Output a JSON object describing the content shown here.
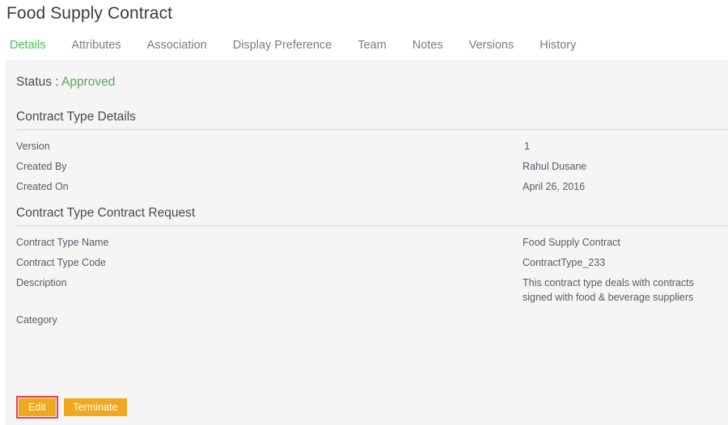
{
  "header": {
    "title": "Food Supply Contract"
  },
  "tabs": [
    {
      "label": "Details",
      "active": true
    },
    {
      "label": "Attributes",
      "active": false
    },
    {
      "label": "Association",
      "active": false
    },
    {
      "label": "Display Preference",
      "active": false
    },
    {
      "label": "Team",
      "active": false
    },
    {
      "label": "Notes",
      "active": false
    },
    {
      "label": "Versions",
      "active": false
    },
    {
      "label": "History",
      "active": false
    }
  ],
  "status": {
    "label": "Status :",
    "value": "Approved"
  },
  "sections": [
    {
      "title": "Contract Type Details",
      "rows": [
        {
          "label": "Version",
          "value": "1"
        },
        {
          "label": "Created By",
          "value": "Rahul Dusane"
        },
        {
          "label": "Created On",
          "value": "April 26, 2016"
        }
      ]
    },
    {
      "title": "Contract Type Contract Request",
      "rows": [
        {
          "label": "Contract Type Name",
          "value": "Food Supply Contract"
        },
        {
          "label": "Contract Type Code",
          "value": "ContractType_233"
        },
        {
          "label": "Description",
          "value": "This contract type deals with contracts\nsigned with food & beverage suppliers"
        },
        {
          "label": "Category",
          "value": ""
        }
      ]
    }
  ],
  "footer": {
    "edit_label": "Edit",
    "terminate_label": "Terminate"
  },
  "colors": {
    "accent_green": "#4cc04c",
    "status_green": "#5ba75b",
    "button_orange": "#f0a81e",
    "highlight_red": "#ef3b4e",
    "panel_gray": "#f5f5f5",
    "text_gray": "#5a5a68"
  }
}
